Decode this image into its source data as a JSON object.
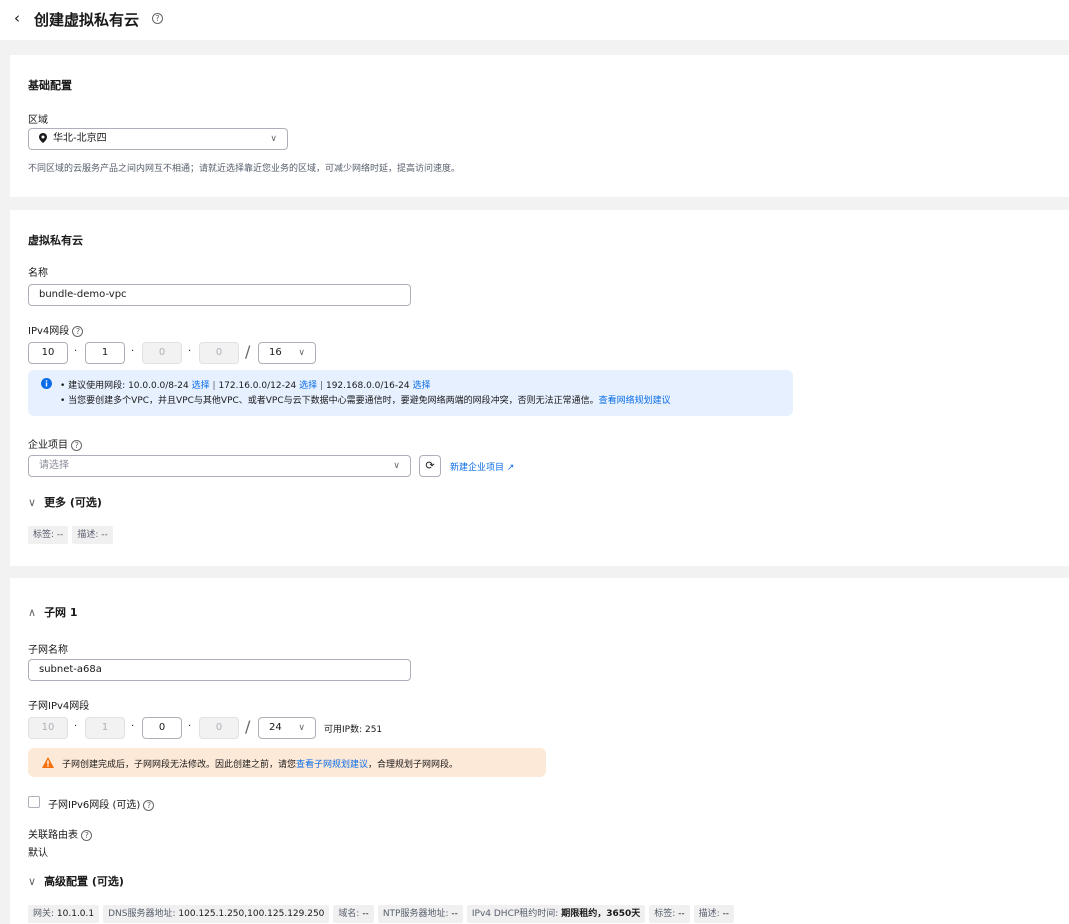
{
  "header": {
    "back_glyph": "‹",
    "title": "创建虚拟私有云",
    "help_glyph": "?"
  },
  "basic": {
    "title": "基础配置",
    "region_label": "区域",
    "region_value": "华北-北京四",
    "region_hint": "不同区域的云服务产品之间内网互不相通；请就近选择靠近您业务的区域，可减少网络时延，提高访问速度。"
  },
  "vpc": {
    "title": "虚拟私有云",
    "name_label": "名称",
    "name_value": "bundle-demo-vpc",
    "ipv4_label": "IPv4网段",
    "ip_octets": [
      "10",
      "1",
      "0",
      "0"
    ],
    "mask": "16",
    "info_line1_prefix": "建议使用网段: 10.0.0.0/8-24",
    "select_label": "选择",
    "info_seg2": "172.16.0.0/12-24",
    "info_seg3": "192.168.0.0/16-24",
    "separator": "|",
    "info_line2": "当您要创建多个VPC，并且VPC与其他VPC、或者VPC与云下数据中心需要通信时，要避免网络两端的网段冲突，否则无法正常通信。",
    "info_line2_link": "查看网络规划建议",
    "enterprise_label": "企业项目",
    "enterprise_placeholder": "请选择",
    "new_enterprise": "新建企业项目",
    "more_label": "更多 (可选)",
    "tags": [
      "标签: --",
      "描述: --"
    ]
  },
  "subnet": {
    "title": "子网 1",
    "name_label": "子网名称",
    "name_value": "subnet-a68a",
    "ipv4_label": "子网IPv4网段",
    "ip_octets": [
      "10",
      "1",
      "0",
      "0"
    ],
    "mask": "24",
    "available_ip": "可用IP数: 251",
    "warn_text": "子网创建完成后，子网网段无法修改。因此创建之前，请您",
    "warn_link": "查看子网规划建议",
    "warn_suffix": "，合理规划子网网段。",
    "ipv6_label": "子网IPv6网段 (可选)",
    "route_label": "关联路由表",
    "route_value": "默认",
    "advanced_label": "高级配置 (可选)",
    "adv_tags": [
      {
        "k": "网关: ",
        "v": "10.1.0.1"
      },
      {
        "k": "DNS服务器地址: ",
        "v": "100.125.1.250,100.125.129.250"
      },
      {
        "k": "域名: ",
        "v": "--"
      },
      {
        "k": "NTP服务器地址: ",
        "v": "--"
      },
      {
        "k": "IPv4 DHCP租约时间: ",
        "v": "期限租约，3650天"
      },
      {
        "k": "标签: ",
        "v": "--"
      },
      {
        "k": "描述: ",
        "v": "--"
      }
    ]
  },
  "colors": {
    "link": "#0a6ce6",
    "info_bg": "#e6f0ff",
    "warn_bg": "#fde9d7",
    "warn_icon": "#f66f0d",
    "info_icon": "#0a6ce6"
  }
}
